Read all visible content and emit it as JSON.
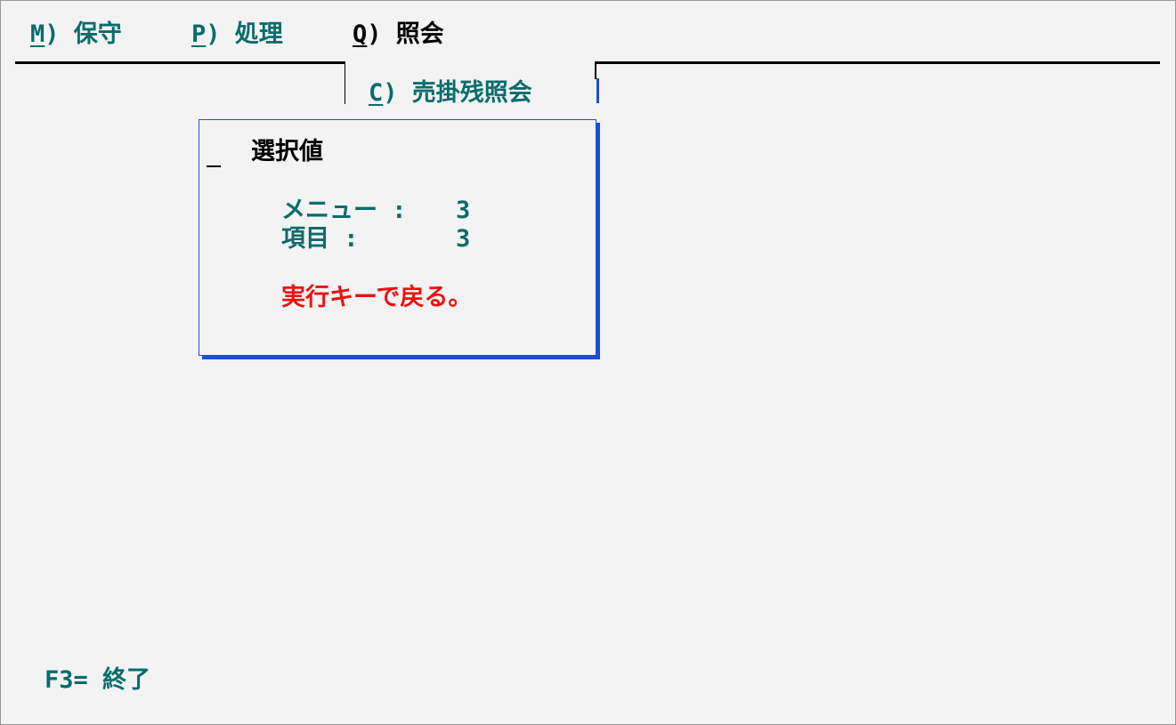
{
  "menubar": {
    "items": [
      {
        "key": "M",
        "label": ") 保守"
      },
      {
        "key": "P",
        "label": ") 処理"
      },
      {
        "key": "Q",
        "label": ") 照会"
      }
    ]
  },
  "submenu": {
    "key": "C",
    "label": ") 売掛残照会"
  },
  "dialog": {
    "title": "選択値",
    "menu_label": "メニュー :",
    "menu_value": "3",
    "item_label": "項目 :",
    "item_value": "3",
    "message": "実行キーで戻る。"
  },
  "footer": {
    "f3": "F3= 終了"
  },
  "colors": {
    "text": "#0a6c6c",
    "selected": "#000000",
    "message": "#f01010",
    "window_border": "#1a4fd6",
    "background": "#f3f3f3"
  }
}
